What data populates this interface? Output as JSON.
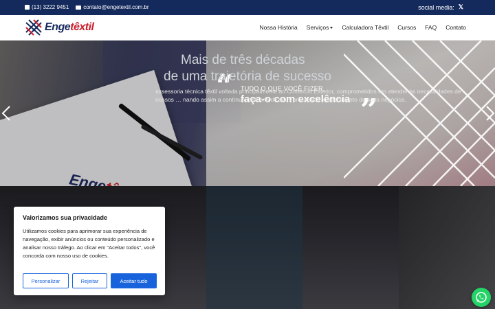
{
  "topbar": {
    "phone": "(13) 3222 9451",
    "email": "contato@engetextil.com.br",
    "social_label": "social media:",
    "social_icon": "x-icon"
  },
  "brand": {
    "name_part1": "Enge",
    "name_part2": "têxtil",
    "primary_color": "#14295c",
    "accent_color": "#c8202c"
  },
  "nav": {
    "items": [
      {
        "label": "Nossa História"
      },
      {
        "label": "Serviços"
      },
      {
        "label": "Calculadora Têxtil"
      },
      {
        "label": "Cursos"
      },
      {
        "label": "FAQ"
      },
      {
        "label": "Contato"
      }
    ]
  },
  "hero": {
    "quote_small": "TUDO O QUE VOCÊ FIZER,",
    "quote_big": "faça-o com excelência",
    "paper_brand_part1": "Enge",
    "paper_brand_part2": "têxtil"
  },
  "about": {
    "title_line1": "Mais de três décadas",
    "title_line2": "de uma trajetória de sucesso",
    "text": "assessoria técnica têxtil voltada principalmente ao Comércio Exterior, comprometidos em atender às necessidades de nossos … nando assim a contínua melhoria de seus processos e crescimento de seus negócios."
  },
  "cookie": {
    "title": "Valorizamos sua privacidade",
    "body": "Utilizamos cookies para aprimorar sua experiência de navegação, exibir anúncios ou conteúdo personalizado e analisar nosso tráfego. Ao clicar em \"Aceitar todos\", você concorda com nosso uso de cookies.",
    "customize_label": "Personalizar",
    "reject_label": "Rejeitar",
    "accept_label": "Aceitar tudo",
    "button_color": "#1863dc"
  },
  "whatsapp": {
    "icon": "whatsapp-icon",
    "color": "#25d366"
  }
}
